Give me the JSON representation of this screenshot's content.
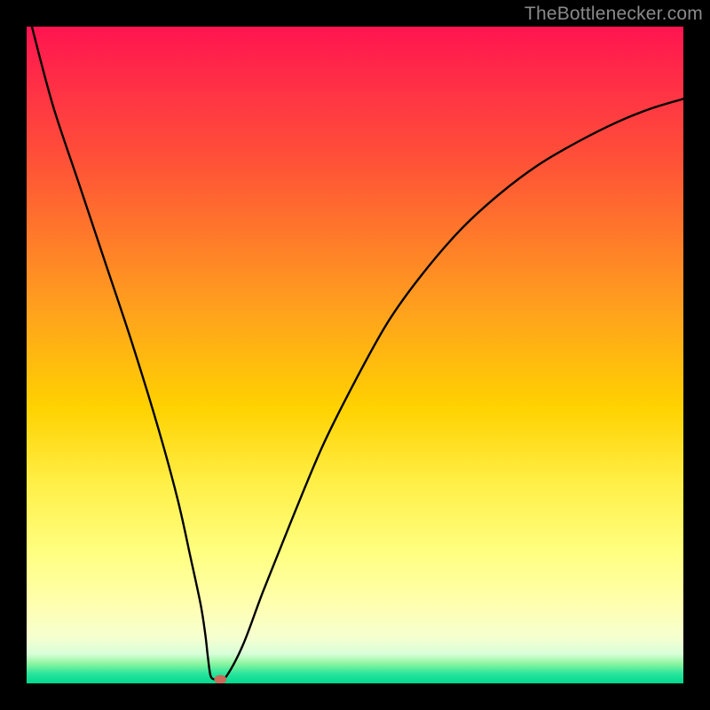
{
  "watermark": "TheBottlenecker.com",
  "chart_data": {
    "type": "line",
    "title": "",
    "xlabel": "",
    "ylabel": "",
    "xlim": [
      0,
      100
    ],
    "ylim": [
      0,
      100
    ],
    "gradient_stops": [
      {
        "pct": 0,
        "color": "#ff1450"
      },
      {
        "pct": 7,
        "color": "#ff2a48"
      },
      {
        "pct": 20,
        "color": "#ff5038"
      },
      {
        "pct": 32,
        "color": "#ff7a2a"
      },
      {
        "pct": 44,
        "color": "#ffa41c"
      },
      {
        "pct": 58,
        "color": "#ffd200"
      },
      {
        "pct": 70,
        "color": "#fff04a"
      },
      {
        "pct": 80,
        "color": "#ffff80"
      },
      {
        "pct": 88,
        "color": "#ffffb0"
      },
      {
        "pct": 93,
        "color": "#f6ffcf"
      },
      {
        "pct": 95.5,
        "color": "#d9ffd9"
      },
      {
        "pct": 97,
        "color": "#8cf5a0"
      },
      {
        "pct": 98.5,
        "color": "#2be59c"
      },
      {
        "pct": 100,
        "color": "#00d88f"
      }
    ],
    "series": [
      {
        "name": "curve",
        "x": [
          0.8,
          4,
          8,
          12,
          16,
          20,
          23,
          25,
          26.5,
          27.2,
          27.6,
          28.0,
          28.6,
          29.4,
          30.5,
          33,
          36,
          40,
          45,
          50,
          55,
          60,
          66,
          72,
          78,
          84,
          90,
          95,
          100
        ],
        "y": [
          100,
          88,
          76,
          64,
          52,
          39,
          28,
          19,
          12,
          7.5,
          4,
          1.2,
          0.6,
          0.6,
          1.2,
          6,
          14,
          24,
          36,
          46,
          55,
          62,
          69,
          74.5,
          79,
          82.5,
          85.5,
          87.5,
          89
        ]
      }
    ],
    "marker": {
      "x": 29.5,
      "y": 0.6,
      "color": "#c96a5a",
      "rx": 7,
      "ry": 5
    }
  }
}
